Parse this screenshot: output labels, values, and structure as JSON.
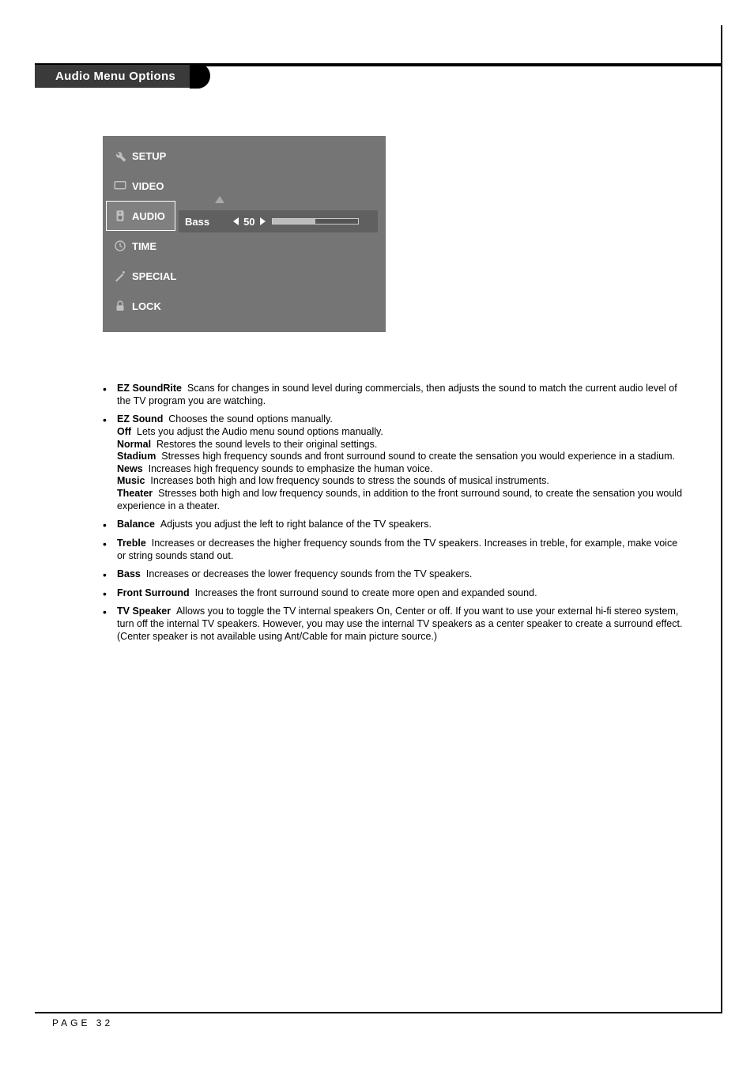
{
  "header": {
    "title": "Audio Menu Options"
  },
  "osd": {
    "items": [
      {
        "label": "SETUP"
      },
      {
        "label": "VIDEO"
      },
      {
        "label": "AUDIO"
      },
      {
        "label": "TIME"
      },
      {
        "label": "SPECIAL"
      },
      {
        "label": "LOCK"
      }
    ],
    "active_index": 2,
    "setting": {
      "name": "Bass",
      "value": "50",
      "percent": 50
    }
  },
  "bullets": {
    "ez_soundrite": {
      "name": "EZ SoundRite",
      "text": "Scans for changes in sound level during commercials, then adjusts the sound to match the current audio level of the TV program you are watching."
    },
    "ez_sound": {
      "name": "EZ Sound",
      "text": "Chooses the sound options manually.",
      "subs": {
        "off": {
          "name": "Off",
          "text": "Lets you adjust the Audio menu sound options manually."
        },
        "normal": {
          "name": "Normal",
          "text": "Restores the sound levels to their original settings."
        },
        "stadium": {
          "name": "Stadium",
          "text": "Stresses high frequency sounds and front surround sound to create the sensation you would experience in a stadium."
        },
        "news": {
          "name": "News",
          "text": "Increases high frequency sounds to emphasize the human voice."
        },
        "music": {
          "name": "Music",
          "text": "Increases both high and low frequency sounds to stress the sounds of musical instruments."
        },
        "theater": {
          "name": "Theater",
          "text": "Stresses both high and low frequency sounds, in addition to the front surround sound, to create the sensation you would experience in a theater."
        }
      }
    },
    "balance": {
      "name": "Balance",
      "text": "Adjusts you adjust the left to right balance of the TV speakers."
    },
    "treble": {
      "name": "Treble",
      "text": "Increases or decreases the higher frequency sounds from the TV speakers. Increases in treble, for example, make voice or string sounds stand out."
    },
    "bass": {
      "name": "Bass",
      "text": "Increases or decreases the lower frequency sounds from the TV speakers."
    },
    "front": {
      "name": "Front Surround",
      "text": "Increases the front surround sound to create more open and expanded sound."
    },
    "tvspk": {
      "name": "TV Speaker",
      "text": "Allows you to toggle the TV internal speakers On, Center or off. If you want to use your external hi-fi stereo system, turn off the internal TV speakers. However, you may use the internal TV speakers as a center speaker to create a surround effect.",
      "note": "(Center speaker is not available using Ant/Cable for main picture source.)"
    }
  },
  "footer": {
    "page": "PAGE 32"
  }
}
